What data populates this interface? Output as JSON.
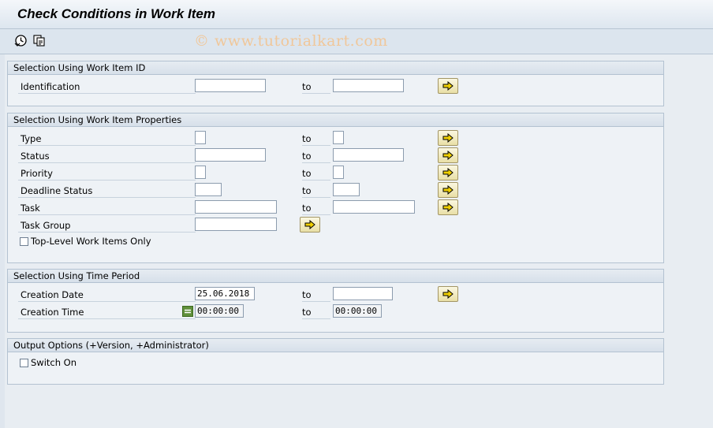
{
  "window": {
    "title": "Check Conditions in Work Item"
  },
  "toolbar": {
    "execute_icon": "execute-clock-icon",
    "variant_icon": "get-variant-icon",
    "watermark": "© www.tutorialkart.com"
  },
  "common": {
    "to_label": "to",
    "arrow_icon": "multiple-selection-arrow-icon"
  },
  "groups": {
    "work_item_id": {
      "header": "Selection Using Work Item ID",
      "identification": {
        "label": "Identification",
        "from": "",
        "to": ""
      }
    },
    "properties": {
      "header": "Selection Using Work Item Properties",
      "type": {
        "label": "Type",
        "from": "",
        "to": ""
      },
      "status": {
        "label": "Status",
        "from": "",
        "to": ""
      },
      "priority": {
        "label": "Priority",
        "from": "",
        "to": ""
      },
      "deadline_status": {
        "label": "Deadline Status",
        "from": "",
        "to": ""
      },
      "task": {
        "label": "Task",
        "from": "",
        "to": ""
      },
      "task_group": {
        "label": "Task Group",
        "value": ""
      },
      "top_level": {
        "label": "Top-Level Work Items Only",
        "checked": false
      }
    },
    "time_period": {
      "header": "Selection Using Time Period",
      "creation_date": {
        "label": "Creation Date",
        "from": "25.06.2018",
        "to": ""
      },
      "creation_time": {
        "label": "Creation Time",
        "from": "00:00:00",
        "to": "00:00:00",
        "operator_icon": "equals-operator-icon"
      }
    },
    "output": {
      "header": "Output Options (+Version, +Administrator)",
      "switch_on": {
        "label": "Switch On",
        "checked": false
      }
    }
  },
  "colors": {
    "background": "#dfe6ee",
    "group_border": "#b3c2d1",
    "arrow_button": "#e9dfa6"
  }
}
